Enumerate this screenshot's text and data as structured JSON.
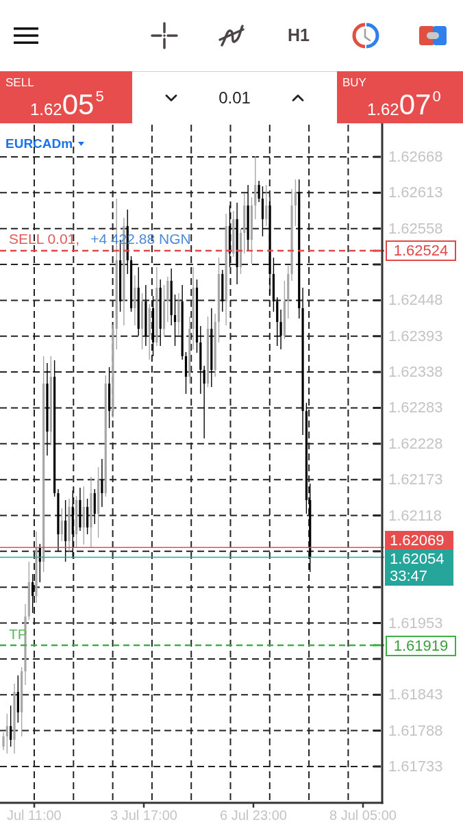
{
  "toolbar": {
    "timeframe": "H1"
  },
  "trade_panel": {
    "sell": {
      "label": "SELL",
      "price_prefix": "1.62",
      "price_main": "05",
      "price_pip": "5"
    },
    "volume": "0.01",
    "buy": {
      "label": "BUY",
      "price_prefix": "1.62",
      "price_main": "07",
      "price_pip": "0"
    }
  },
  "chart": {
    "symbol": "EURCADm",
    "price_axis": [
      "1.62668",
      "1.62613",
      "1.62558",
      "1.62448",
      "1.62393",
      "1.62338",
      "1.62283",
      "1.62228",
      "1.62173",
      "1.62118",
      "1.61953",
      "1.61843",
      "1.61788",
      "1.61733"
    ],
    "time_axis": [
      "Jul 11:00",
      "3 Jul 17:00",
      "6 Jul 23:00",
      "8 Jul 05:00"
    ],
    "price_lines": [
      {
        "kind": "position",
        "label": "SELL 0.01,",
        "profit": "+4 422.88 NGN",
        "price": "1.62524"
      },
      {
        "kind": "ask",
        "price": "1.62069"
      },
      {
        "kind": "bid",
        "price": "1.62054",
        "countdown": "33:47"
      },
      {
        "kind": "take_profit",
        "label": "TP",
        "price": "1.61919"
      }
    ]
  }
}
